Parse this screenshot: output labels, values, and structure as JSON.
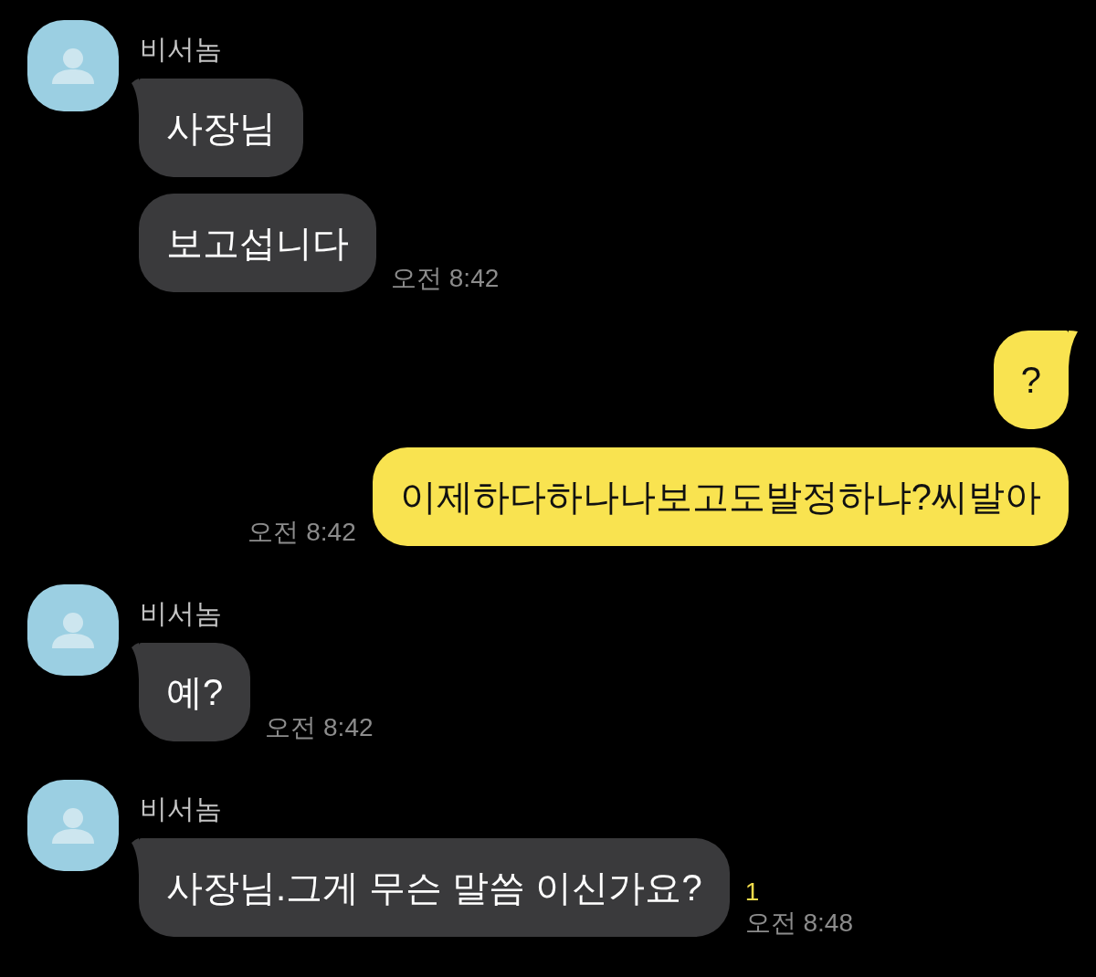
{
  "messages": [
    {
      "kind": "received",
      "sender": "비서놈",
      "bubbles": [
        "사장님",
        "보고섭니다"
      ],
      "time": "오전 8:42"
    },
    {
      "kind": "sent",
      "bubbles": [
        "?",
        "이제하다하나나보고도발정하냐?씨발아"
      ],
      "time": "오전 8:42"
    },
    {
      "kind": "received",
      "sender": "비서놈",
      "bubbles": [
        "예?"
      ],
      "time": "오전 8:42"
    },
    {
      "kind": "received",
      "sender": "비서놈",
      "bubbles": [
        "사장님.그게 무슨 말씀 이신가요?"
      ],
      "unread_count": "1",
      "time": "오전 8:48"
    }
  ]
}
